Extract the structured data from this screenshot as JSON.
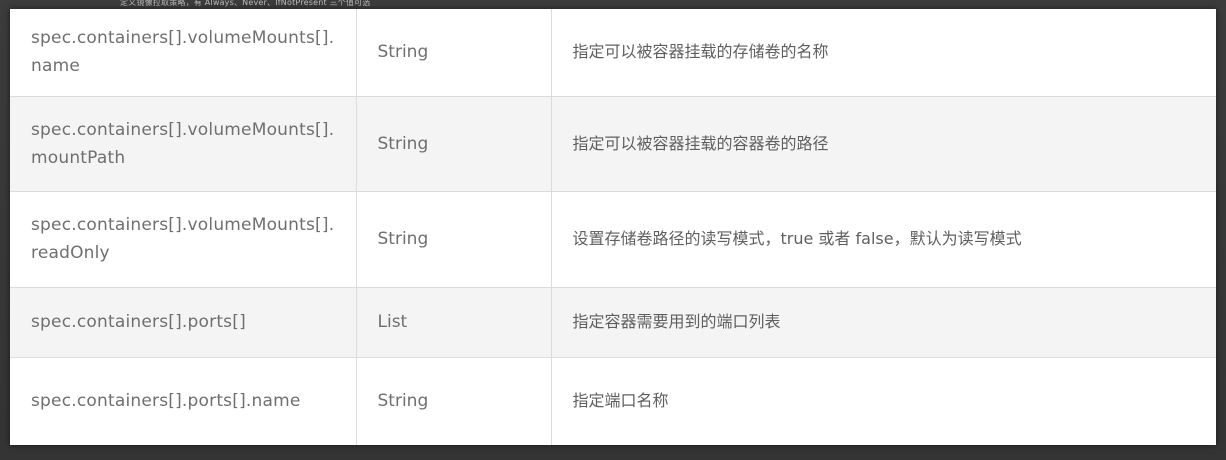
{
  "background_note_text": "定义镜像拉取策略，有 Always、Never、IfNotPresent 三个值可选",
  "table": {
    "rows": [
      {
        "name": "spec.containers[].volumeMounts[].name",
        "type": "String",
        "description": "指定可以被容器挂载的存储卷的名称"
      },
      {
        "name": "spec.containers[].volumeMounts[].mountPath",
        "type": "String",
        "description": "指定可以被容器挂载的容器卷的路径"
      },
      {
        "name": "spec.containers[].volumeMounts[].readOnly",
        "type": "String",
        "description": "设置存储卷路径的读写模式，true 或者 false，默认为读写模式"
      },
      {
        "name": "spec.containers[].ports[]",
        "type": "List",
        "description": "指定容器需要用到的端口列表"
      },
      {
        "name": "spec.containers[].ports[].name",
        "type": "String",
        "description": "指定端口名称"
      }
    ]
  }
}
